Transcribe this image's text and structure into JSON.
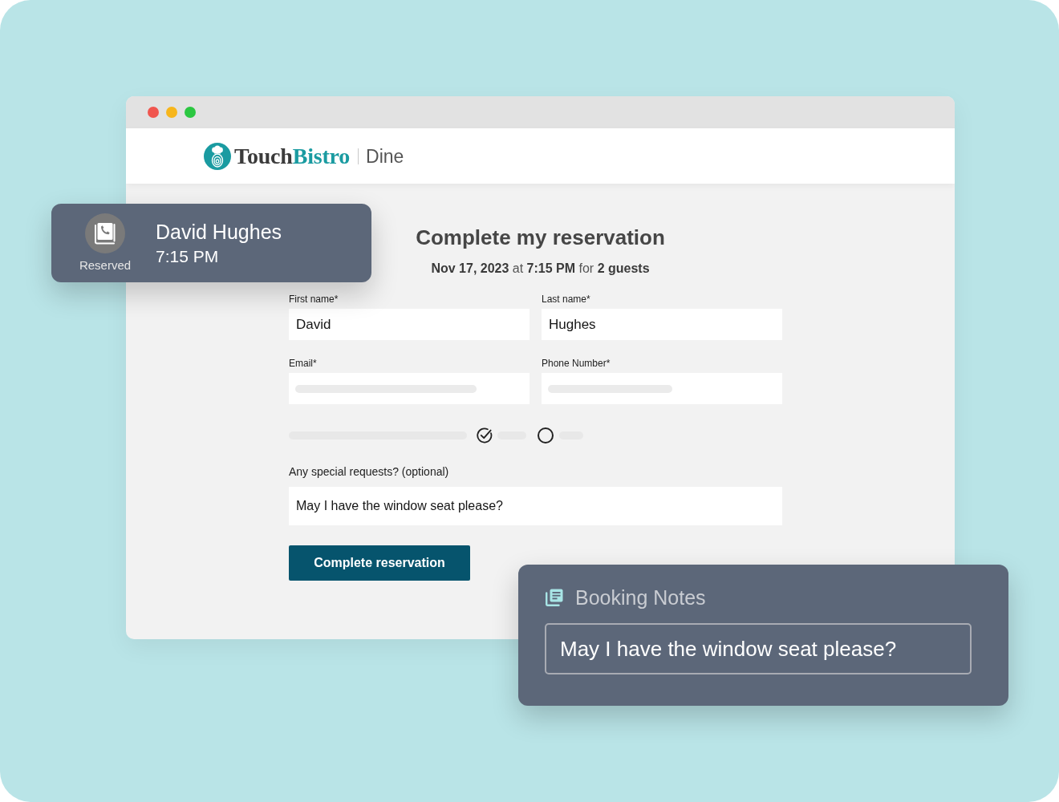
{
  "header": {
    "logo": {
      "primary": "Touch",
      "accent": "Bistro"
    },
    "product": "Dine"
  },
  "form": {
    "title": "Complete my reservation",
    "summary": "**Nov 17, 2023** at **7:15 PM** for **2 guests**",
    "fields": [
      {
        "label": "First name*",
        "kind": "text",
        "value": "David"
      },
      {
        "label": "Last name*",
        "kind": "text",
        "value": "Hughes"
      },
      {
        "label": "Email*",
        "kind": "skeleton"
      },
      {
        "label": "Phone Number*",
        "kind": "skeleton"
      }
    ],
    "choices": [
      {
        "selected": true
      },
      {
        "selected": false
      }
    ],
    "requests": {
      "label": "Any special requests? (optional)",
      "value": "May I have the window seat please?"
    },
    "submit_button": "Complete reservation"
  },
  "reservation_card": {
    "status": "Reserved",
    "guest_name": "David Hughes",
    "time": "7:15 PM"
  },
  "booking_notes": {
    "title": "Booking Notes",
    "note": "May I have the window seat please?"
  }
}
